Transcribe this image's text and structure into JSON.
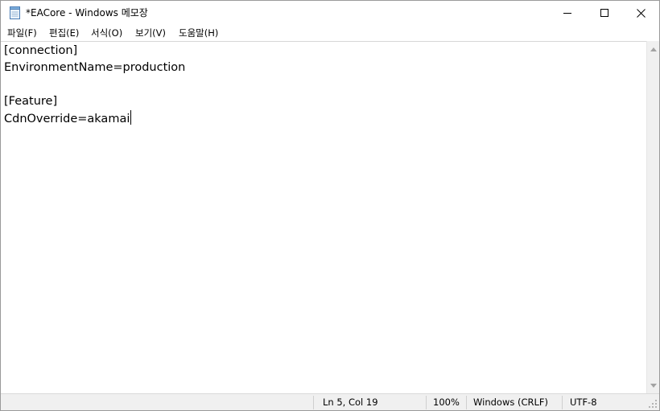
{
  "window": {
    "title": "*EACore - Windows 메모장"
  },
  "menu": {
    "items": [
      "파일(F)",
      "편집(E)",
      "서식(O)",
      "보기(V)",
      "도움말(H)"
    ]
  },
  "editor": {
    "lines": [
      "[connection]",
      "EnvironmentName=production",
      "",
      "[Feature]",
      "CdnOverride=akamai"
    ]
  },
  "status": {
    "position": "Ln 5, Col 19",
    "zoom": "100%",
    "line_ending": "Windows (CRLF)",
    "encoding": "UTF-8"
  },
  "icons": {
    "app": "notepad-icon",
    "minimize": "minimize-icon",
    "maximize": "maximize-icon",
    "close": "close-icon"
  }
}
